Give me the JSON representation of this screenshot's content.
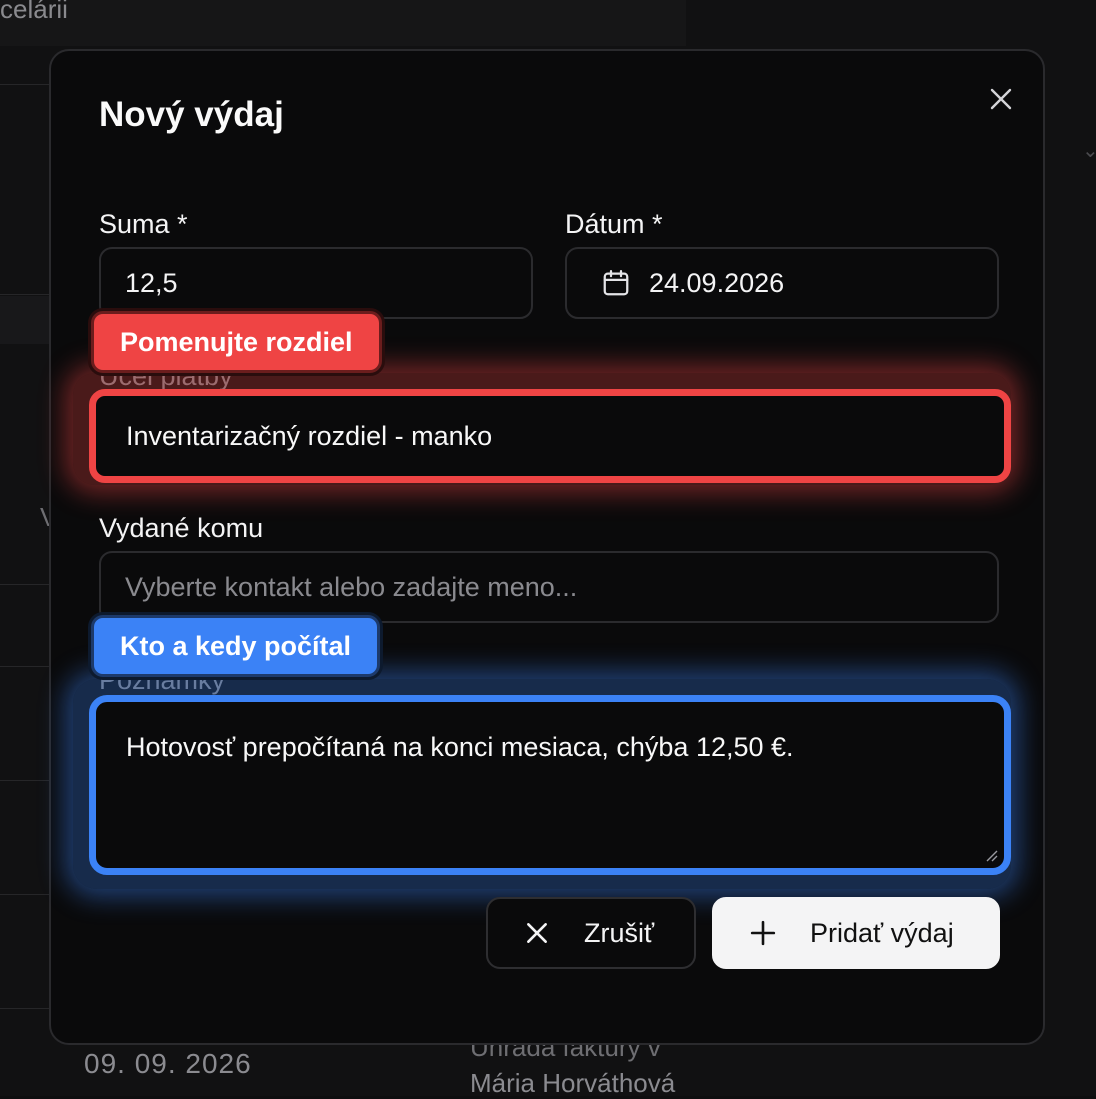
{
  "background": {
    "top_title": "celárii",
    "partial_letter": "V",
    "row_date": "09. 09. 2026",
    "row_description": "Úhrada faktúry v",
    "row_name": "Mária Horváthová"
  },
  "modal": {
    "title": "Nový výdaj",
    "fields": {
      "amount": {
        "label": "Suma *",
        "value": "12,5"
      },
      "date": {
        "label": "Dátum *",
        "value": "24.09.2026",
        "icon": "calendar-icon"
      },
      "purpose": {
        "label": "Účel platby *",
        "value": "Inventarizačný rozdiel - manko"
      },
      "issued_to": {
        "label": "Vydané komu",
        "placeholder": "Vyberte kontakt alebo zadajte meno..."
      },
      "notes": {
        "label": "Poznámky",
        "value": "Hotovosť prepočítaná na konci mesiaca, chýba 12,50 €."
      }
    },
    "buttons": {
      "cancel": {
        "label": "Zrušiť",
        "icon": "close-icon"
      },
      "add": {
        "label": "Pridať výdaj",
        "icon": "plus-icon"
      }
    }
  },
  "annotations": {
    "red_tag": {
      "text": "Pomenujte rozdiel",
      "color": "#ef4444"
    },
    "blue_tag": {
      "text": "Kto a kedy počítal",
      "color": "#3b82f6"
    }
  }
}
